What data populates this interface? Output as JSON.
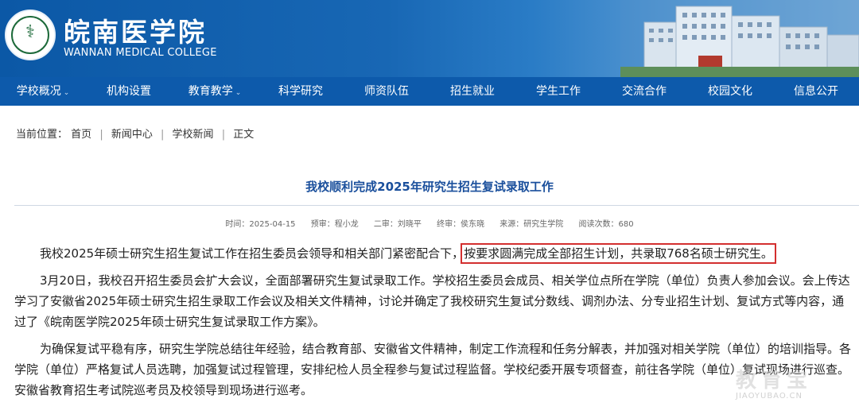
{
  "header": {
    "school_name_cn": "皖南医学院",
    "school_name_en": "WANNAN MEDICAL COLLEGE",
    "brand_color": "#0d5aab"
  },
  "nav": {
    "items": [
      {
        "label": "学校概况",
        "dropdown": true
      },
      {
        "label": "机构设置",
        "dropdown": false
      },
      {
        "label": "教育教学",
        "dropdown": true
      },
      {
        "label": "科学研究",
        "dropdown": false
      },
      {
        "label": "师资队伍",
        "dropdown": false
      },
      {
        "label": "招生就业",
        "dropdown": false
      },
      {
        "label": "学生工作",
        "dropdown": false
      },
      {
        "label": "交流合作",
        "dropdown": false
      },
      {
        "label": "校园文化",
        "dropdown": false
      },
      {
        "label": "信息公开",
        "dropdown": false
      }
    ],
    "chevron": "⌄"
  },
  "breadcrumb": {
    "prefix": "当前位置：",
    "items": [
      "首页",
      "新闻中心",
      "学校新闻",
      "正文"
    ],
    "separator": "|"
  },
  "article": {
    "title": "我校顺利完成2025年研究生招生复试录取工作",
    "meta": {
      "time_label": "时间：",
      "time": "2025-04-15",
      "review1_label": "预审：",
      "review1": "程小龙",
      "review2_label": "二审：",
      "review2": "刘晓平",
      "review3_label": "终审：",
      "review3": "侯东晓",
      "source_label": "来源：",
      "source": "研究生学院",
      "views_label": "阅读次数：",
      "views": "680"
    },
    "p1_before": "我校2025年硕士研究生招生复试工作在招生委员会领导和相关部门紧密配合下，",
    "p1_highlight": "按要求圆满完成全部招生计划，共录取768名硕士研究生。",
    "p2": "3月20日，我校召开招生委员会扩大会议，全面部署研究生复试录取工作。学校招生委员会成员、相关学位点所在学院（单位）负责人参加会议。会上传达学习了安徽省2025年硕士研究生招生录取工作会议及相关文件精神，讨论并确定了我校研究生复试分数线、调剂办法、分专业招生计划、复试方式等内容，通过了《皖南医学院2025年硕士研究生复试录取工作方案》。",
    "p3": "为确保复试平稳有序，研究生学院总结往年经验，结合教育部、安徽省文件精神，制定工作流程和任务分解表，并加强对相关学院（单位）的培训指导。各学院（单位）严格复试人员选聘，加强复试过程管理，安排纪检人员全程参与复试过程监督。学校纪委开展专项督查，前往各学院（单位）复试现场进行巡查。安徽省教育招生考试院巡考员及校领导到现场进行巡考。",
    "highlight_color": "#d32f2f"
  },
  "watermark": {
    "cn": "教育宝",
    "en": "JIAOYUBAO.CN"
  }
}
